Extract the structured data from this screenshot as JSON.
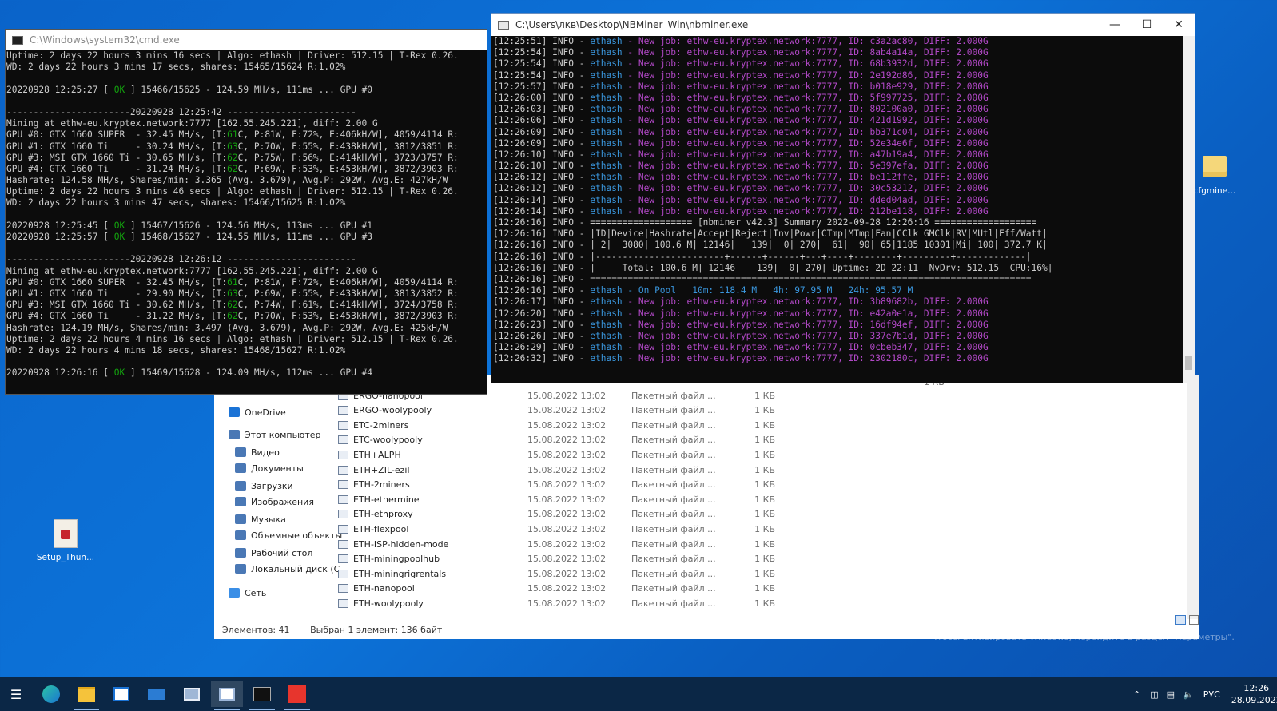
{
  "cmd": {
    "title": "C:\\Windows\\system32\\cmd.exe",
    "lines": [
      "Uptime: 2 days 22 hours 3 mins 16 secs | Algo: ethash | Driver: 512.15 | T-Rex 0.26.",
      "WD: 2 days 22 hours 3 mins 17 secs, shares: 15465/15624 R:1.02%",
      "",
      "20220928 12:25:27 [ OK ] 15466/15625 - 124.59 MH/s, 111ms ... GPU #0",
      "",
      "-----------------------20220928 12:25:42 ------------------------",
      "Mining at ethw-eu.kryptex.network:7777 [162.55.245.221], diff: 2.00 G",
      "GPU #0: GTX 1660 SUPER  - 32.45 MH/s, [T:61C, P:81W, F:72%, E:406kH/W], 4059/4114 R:",
      "GPU #1: GTX 1660 Ti     - 30.24 MH/s, [T:63C, P:70W, F:55%, E:438kH/W], 3812/3851 R:",
      "GPU #3: MSI GTX 1660 Ti - 30.65 MH/s, [T:62C, P:75W, F:56%, E:414kH/W], 3723/3757 R:",
      "GPU #4: GTX 1660 Ti     - 31.24 MH/s, [T:62C, P:69W, F:53%, E:453kH/W], 3872/3903 R:",
      "Hashrate: 124.58 MH/s, Shares/min: 3.365 (Avg. 3.679), Avg.P: 292W, Avg.E: 427kH/W",
      "Uptime: 2 days 22 hours 3 mins 46 secs | Algo: ethash | Driver: 512.15 | T-Rex 0.26.",
      "WD: 2 days 22 hours 3 mins 47 secs, shares: 15466/15625 R:1.02%",
      "",
      "20220928 12:25:45 [ OK ] 15467/15626 - 124.56 MH/s, 113ms ... GPU #1",
      "20220928 12:25:57 [ OK ] 15468/15627 - 124.55 MH/s, 111ms ... GPU #3",
      "",
      "-----------------------20220928 12:26:12 ------------------------",
      "Mining at ethw-eu.kryptex.network:7777 [162.55.245.221], diff: 2.00 G",
      "GPU #0: GTX 1660 SUPER  - 32.45 MH/s, [T:61C, P:81W, F:72%, E:406kH/W], 4059/4114 R:",
      "GPU #1: GTX 1660 Ti     - 29.90 MH/s, [T:63C, P:69W, F:55%, E:433kH/W], 3813/3852 R:",
      "GPU #3: MSI GTX 1660 Ti - 30.62 MH/s, [T:62C, P:74W, F:61%, E:414kH/W], 3724/3758 R:",
      "GPU #4: GTX 1660 Ti     - 31.22 MH/s, [T:62C, P:70W, F:53%, E:453kH/W], 3872/3903 R:",
      "Hashrate: 124.19 MH/s, Shares/min: 3.497 (Avg. 3.679), Avg.P: 292W, Avg.E: 425kH/W",
      "Uptime: 2 days 22 hours 4 mins 16 secs | Algo: ethash | Driver: 512.15 | T-Rex 0.26.",
      "WD: 2 days 22 hours 4 mins 18 secs, shares: 15468/15627 R:1.02%",
      "",
      "20220928 12:26:16 [ OK ] 15469/15628 - 124.09 MH/s, 112ms ... GPU #4"
    ]
  },
  "nbminer": {
    "title": "C:\\Users\\лкв\\Desktop\\NBMiner_Win\\nbminer.exe",
    "lines": [
      "[12:25:51] INFO - ethash - New job: ethw-eu.kryptex.network:7777, ID: c3a2ac80, DIFF: 2.000G",
      "[12:25:54] INFO - ethash - New job: ethw-eu.kryptex.network:7777, ID: 8ab4a14a, DIFF: 2.000G",
      "[12:25:54] INFO - ethash - New job: ethw-eu.kryptex.network:7777, ID: 68b3932d, DIFF: 2.000G",
      "[12:25:54] INFO - ethash - New job: ethw-eu.kryptex.network:7777, ID: 2e192d86, DIFF: 2.000G",
      "[12:25:57] INFO - ethash - New job: ethw-eu.kryptex.network:7777, ID: b018e929, DIFF: 2.000G",
      "[12:26:00] INFO - ethash - New job: ethw-eu.kryptex.network:7777, ID: 5f997725, DIFF: 2.000G",
      "[12:26:03] INFO - ethash - New job: ethw-eu.kryptex.network:7777, ID: 802100a0, DIFF: 2.000G",
      "[12:26:06] INFO - ethash - New job: ethw-eu.kryptex.network:7777, ID: 421d1992, DIFF: 2.000G",
      "[12:26:09] INFO - ethash - New job: ethw-eu.kryptex.network:7777, ID: bb371c04, DIFF: 2.000G",
      "[12:26:09] INFO - ethash - New job: ethw-eu.kryptex.network:7777, ID: 52e34e6f, DIFF: 2.000G",
      "[12:26:10] INFO - ethash - New job: ethw-eu.kryptex.network:7777, ID: a47b19a4, DIFF: 2.000G",
      "[12:26:10] INFO - ethash - New job: ethw-eu.kryptex.network:7777, ID: 5e397efa, DIFF: 2.000G",
      "[12:26:12] INFO - ethash - New job: ethw-eu.kryptex.network:7777, ID: be112ffe, DIFF: 2.000G",
      "[12:26:12] INFO - ethash - New job: ethw-eu.kryptex.network:7777, ID: 30c53212, DIFF: 2.000G",
      "[12:26:14] INFO - ethash - New job: ethw-eu.kryptex.network:7777, ID: dded04ad, DIFF: 2.000G",
      "[12:26:14] INFO - ethash - New job: ethw-eu.kryptex.network:7777, ID: 212be118, DIFF: 2.000G",
      "[12:26:16] INFO - =================== [nbminer v42.3] Summary 2022-09-28 12:26:16 ===================",
      "[12:26:16] INFO - |ID|Device|Hashrate|Accept|Reject|Inv|Powr|CTmp|MTmp|Fan|CClk|GMClk|RV|MUtl|Eff/Watt|",
      "[12:26:16] INFO - | 2|  3080| 100.6 M| 12146|   139|  0| 270|  61|  90| 65|1185|10301|Mi| 100| 372.7 K|",
      "[12:26:16] INFO - |------------------------+------+------+---+----+--------+---------+-------------|",
      "[12:26:16] INFO - |     Total: 100.6 M| 12146|   139|  0| 270| Uptime: 2D 22:11  NvDrv: 512.15  CPU:16%|",
      "[12:26:16] INFO - ==================================================================================",
      "[12:26:16] INFO - ethash - On Pool   10m: 118.4 M   4h: 97.95 M   24h: 95.57 M",
      "[12:26:17] INFO - ethash - New job: ethw-eu.kryptex.network:7777, ID: 3b89682b, DIFF: 2.000G",
      "[12:26:20] INFO - ethash - New job: ethw-eu.kryptex.network:7777, ID: e42a0e1a, DIFF: 2.000G",
      "[12:26:23] INFO - ethash - New job: ethw-eu.kryptex.network:7777, ID: 16df94ef, DIFF: 2.000G",
      "[12:26:26] INFO - ethash - New job: ethw-eu.kryptex.network:7777, ID: 337e7b1d, DIFF: 2.000G",
      "[12:26:29] INFO - ethash - New job: ethw-eu.kryptex.network:7777, ID: 0cbeb347, DIFF: 2.000G",
      "[12:26:32] INFO - ethash - New job: ethw-eu.kryptex.network:7777, ID: 2302180c, DIFF: 2.000G"
    ]
  },
  "explorer": {
    "nav": [
      {
        "label": "Музыка",
        "icon": "music-icon"
      },
      {
        "label": "OneDrive",
        "icon": "cloud-icon"
      },
      {
        "label": "Этот компьютер",
        "icon": "computer-icon"
      },
      {
        "label": "Видео",
        "icon": "video-icon"
      },
      {
        "label": "Документы",
        "icon": "documents-icon"
      },
      {
        "label": "Загрузки",
        "icon": "downloads-icon"
      },
      {
        "label": "Изображения",
        "icon": "pictures-icon"
      },
      {
        "label": "Музыка",
        "icon": "music-icon"
      },
      {
        "label": "Объемные объекты",
        "icon": "3d-objects-icon"
      },
      {
        "label": "Рабочий стол",
        "icon": "desktop-icon"
      },
      {
        "label": "Локальный диск (C",
        "icon": "drive-icon"
      },
      {
        "label": "Сеть",
        "icon": "network-icon"
      }
    ],
    "top_size": "1 КБ",
    "files": [
      {
        "name": "ERGO-nanopool",
        "date": "15.08.2022 13:02",
        "type": "Пакетный файл ...",
        "size": "1 КБ"
      },
      {
        "name": "ERGO-woolypooly",
        "date": "15.08.2022 13:02",
        "type": "Пакетный файл ...",
        "size": "1 КБ"
      },
      {
        "name": "ETC-2miners",
        "date": "15.08.2022 13:02",
        "type": "Пакетный файл ...",
        "size": "1 КБ"
      },
      {
        "name": "ETC-woolypooly",
        "date": "15.08.2022 13:02",
        "type": "Пакетный файл ...",
        "size": "1 КБ"
      },
      {
        "name": "ETH+ALPH",
        "date": "15.08.2022 13:02",
        "type": "Пакетный файл ...",
        "size": "1 КБ"
      },
      {
        "name": "ETH+ZIL-ezil",
        "date": "15.08.2022 13:02",
        "type": "Пакетный файл ...",
        "size": "1 КБ"
      },
      {
        "name": "ETH-2miners",
        "date": "15.08.2022 13:02",
        "type": "Пакетный файл ...",
        "size": "1 КБ"
      },
      {
        "name": "ETH-ethermine",
        "date": "15.08.2022 13:02",
        "type": "Пакетный файл ...",
        "size": "1 КБ"
      },
      {
        "name": "ETH-ethproxy",
        "date": "15.08.2022 13:02",
        "type": "Пакетный файл ...",
        "size": "1 КБ"
      },
      {
        "name": "ETH-flexpool",
        "date": "15.08.2022 13:02",
        "type": "Пакетный файл ...",
        "size": "1 КБ"
      },
      {
        "name": "ETH-ISP-hidden-mode",
        "date": "15.08.2022 13:02",
        "type": "Пакетный файл ...",
        "size": "1 КБ"
      },
      {
        "name": "ETH-miningpoolhub",
        "date": "15.08.2022 13:02",
        "type": "Пакетный файл ...",
        "size": "1 КБ"
      },
      {
        "name": "ETH-miningrigrentals",
        "date": "15.08.2022 13:02",
        "type": "Пакетный файл ...",
        "size": "1 КБ"
      },
      {
        "name": "ETH-nanopool",
        "date": "15.08.2022 13:02",
        "type": "Пакетный файл ...",
        "size": "1 КБ"
      },
      {
        "name": "ETH-woolypooly",
        "date": "15.08.2022 13:02",
        "type": "Пакетный файл ...",
        "size": "1 КБ"
      }
    ],
    "status_count": "Элементов: 41",
    "status_selected": "Выбран 1 элемент: 136 байт"
  },
  "desktop": {
    "icon_setup": "Setup_Thun...",
    "icon_cfg": "cfgmine...",
    "watermark_title": "Активация Windows",
    "watermark_sub": "Чтобы активировать Windows, перейдите в раздел \"Параметры\"."
  },
  "taskbar": {
    "lang": "РУС",
    "time": "12:26",
    "date": "28.09.2022",
    "apps": [
      "task-view-icon",
      "edge-icon",
      "file-explorer-icon",
      "store-icon",
      "mail-icon",
      "remote-desktop-icon",
      "explorer-window-icon",
      "cmd-icon",
      "anydesk-icon"
    ]
  },
  "colors": {
    "accent": "#0a63c9",
    "ok": "#13a10e",
    "job": "#9e3fd6",
    "taskbar": "#0b2746"
  }
}
